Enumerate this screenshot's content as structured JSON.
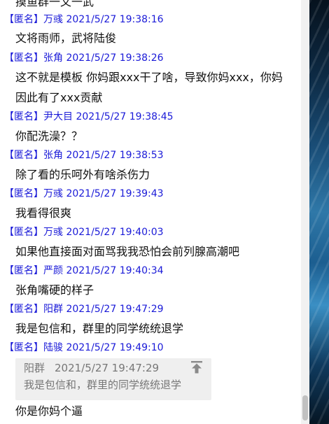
{
  "anon_tag": "【匿名】",
  "top_partial": "摸鱼群一文一武",
  "messages": [
    {
      "name": "万彧",
      "time": "2021/5/27 19:38:16",
      "lines": [
        "文将雨师，武将陆俊"
      ]
    },
    {
      "name": "张角",
      "time": "2021/5/27 19:38:26",
      "lines": [
        "这不就是模板 你妈跟xxx干了啥，导致你妈xxx，你妈",
        "因此有了xxx贡献"
      ]
    },
    {
      "name": "尹大目",
      "time": "2021/5/27 19:38:45",
      "lines": [
        "你配洗澡？？"
      ]
    },
    {
      "name": "张角",
      "time": "2021/5/27 19:38:53",
      "lines": [
        "除了看的乐呵外有啥杀伤力"
      ]
    },
    {
      "name": "万彧",
      "time": "2021/5/27 19:39:43",
      "lines": [
        "我看得很爽"
      ]
    },
    {
      "name": "万彧",
      "time": "2021/5/27 19:40:03",
      "lines": [
        "如果他直接面对面骂我我恐怕会前列腺高潮吧"
      ]
    },
    {
      "name": "严颜",
      "time": "2021/5/27 19:40:34",
      "lines": [
        "张角嘴硬的样子"
      ]
    },
    {
      "name": "阳群",
      "time": "2021/5/27 19:47:29",
      "lines": [
        "我是包信和，群里的同学统统退学"
      ]
    },
    {
      "name": "陆骏",
      "time": "2021/5/27 19:49:10",
      "lines": [
        "你是你妈个逼"
      ]
    }
  ],
  "quote": {
    "name": "阳群",
    "time": "2021/5/27 19:47:29",
    "text": "我是包信和，群里的同学统统退学",
    "icon": "jump-to-top-icon"
  },
  "colors": {
    "header": "#1a1ad8",
    "message": "#111111",
    "quote_bg": "#efefef",
    "quote_text": "#777777"
  }
}
